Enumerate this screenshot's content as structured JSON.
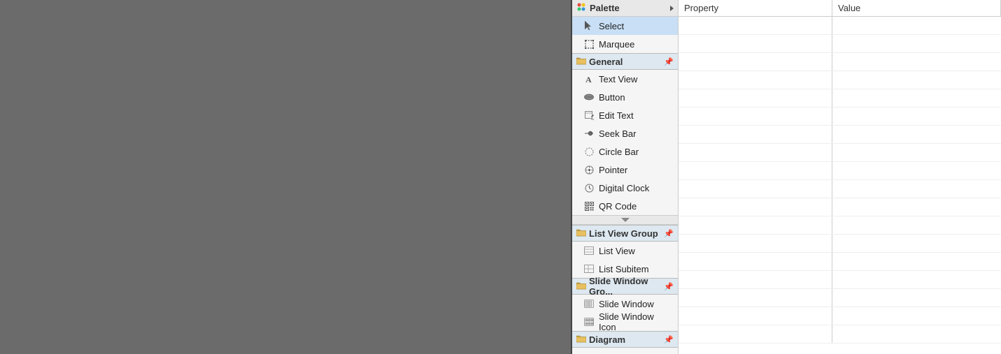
{
  "canvas": {
    "background": "#6b6b6b"
  },
  "palette": {
    "header_label": "Palette",
    "arrow_icon": "arrow-right",
    "top_items": [
      {
        "id": "select",
        "label": "Select",
        "icon": "cursor"
      },
      {
        "id": "marquee",
        "label": "Marquee",
        "icon": "marquee"
      }
    ],
    "groups": [
      {
        "id": "general",
        "label": "General",
        "pin_icon": "pin",
        "items": [
          {
            "id": "text-view",
            "label": "Text View",
            "icon": "text"
          },
          {
            "id": "button",
            "label": "Button",
            "icon": "button"
          },
          {
            "id": "edit-text",
            "label": "Edit Text",
            "icon": "edit"
          },
          {
            "id": "seek-bar",
            "label": "Seek Bar",
            "icon": "seekbar"
          },
          {
            "id": "circle-bar",
            "label": "Circle Bar",
            "icon": "circle"
          },
          {
            "id": "pointer",
            "label": "Pointer",
            "icon": "pointer"
          },
          {
            "id": "digital-clock",
            "label": "Digital Clock",
            "icon": "clock"
          },
          {
            "id": "qr-code",
            "label": "QR Code",
            "icon": "qr"
          }
        ]
      },
      {
        "id": "list-view-group",
        "label": "List View Group",
        "pin_icon": "pin",
        "items": [
          {
            "id": "list-view",
            "label": "List View",
            "icon": "list"
          },
          {
            "id": "list-subitem",
            "label": "List Subitem",
            "icon": "list-sub"
          }
        ]
      },
      {
        "id": "slide-window-group",
        "label": "Slide Window Gro...",
        "pin_icon": "pin",
        "items": [
          {
            "id": "slide-window",
            "label": "Slide Window",
            "icon": "slide"
          },
          {
            "id": "slide-window-icon",
            "label": "Slide Window Icon",
            "icon": "slide-icon"
          }
        ]
      },
      {
        "id": "diagram",
        "label": "Diagram",
        "pin_icon": "pin",
        "items": []
      }
    ]
  },
  "properties": {
    "col1_label": "Property",
    "col2_label": "Value",
    "rows": [
      {
        "property": "",
        "value": ""
      },
      {
        "property": "",
        "value": ""
      },
      {
        "property": "",
        "value": ""
      },
      {
        "property": "",
        "value": ""
      },
      {
        "property": "",
        "value": ""
      },
      {
        "property": "",
        "value": ""
      },
      {
        "property": "",
        "value": ""
      },
      {
        "property": "",
        "value": ""
      },
      {
        "property": "",
        "value": ""
      },
      {
        "property": "",
        "value": ""
      },
      {
        "property": "",
        "value": ""
      },
      {
        "property": "",
        "value": ""
      },
      {
        "property": "",
        "value": ""
      },
      {
        "property": "",
        "value": ""
      },
      {
        "property": "",
        "value": ""
      },
      {
        "property": "",
        "value": ""
      },
      {
        "property": "",
        "value": ""
      },
      {
        "property": "",
        "value": ""
      }
    ]
  }
}
